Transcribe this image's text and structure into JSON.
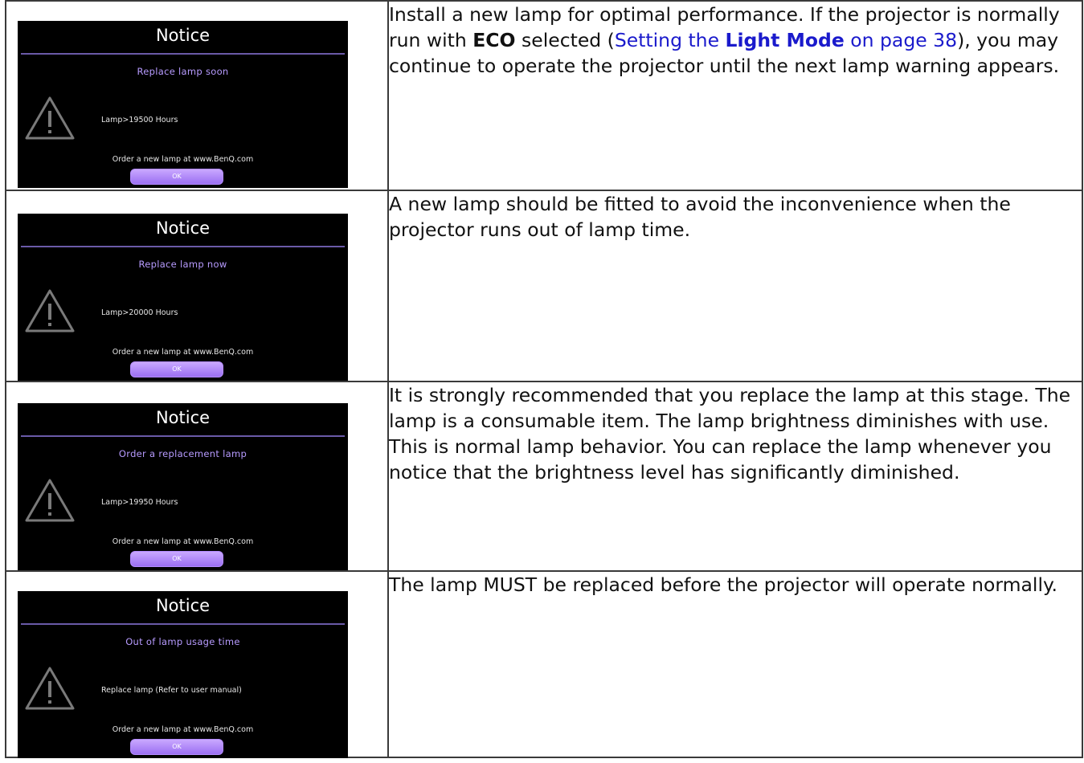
{
  "rows": [
    {
      "dialog": {
        "title": "Notice",
        "message": "Replace lamp soon",
        "detail": "Lamp>19500 Hours",
        "order": "Order a new lamp at www.BenQ.com",
        "button": "OK"
      },
      "text": {
        "p1": "Install a new lamp for optimal performance. If the projector is normally run with ",
        "kw1": "ECO",
        "p2": " selected (",
        "link_pre": "Setting the ",
        "link_kw": "Light Mode",
        "link_post": " on page 38",
        "p3": "), you may continue to operate the projector until the next lamp warning appears."
      }
    },
    {
      "dialog": {
        "title": "Notice",
        "message": "Replace lamp now",
        "detail": "Lamp>20000 Hours",
        "order": "Order a new lamp at www.BenQ.com",
        "button": "OK"
      },
      "text": "A new lamp should be fitted to avoid the inconvenience when the projector runs out of lamp time."
    },
    {
      "dialog": {
        "title": "Notice",
        "message": "Order a replacement lamp",
        "detail": "Lamp>19950 Hours",
        "order": "Order a new lamp at www.BenQ.com",
        "button": "OK"
      },
      "text": "It is strongly recommended that you replace the lamp at this stage. The lamp is a consumable item. The lamp brightness diminishes with use. This is normal lamp behavior. You can replace the lamp whenever you notice that the brightness level has significantly diminished."
    },
    {
      "dialog": {
        "title": "Notice",
        "message": "Out of lamp usage time",
        "detail": "Replace lamp (Refer to user manual)",
        "order": "Order a new lamp at www.BenQ.com",
        "button": "OK"
      },
      "text": "The lamp MUST be replaced before the projector will operate normally."
    }
  ],
  "colors": {
    "dialog_bg": "#000000",
    "accent_purple": "#b79bff",
    "link_blue": "#1a1acc"
  },
  "icons": {
    "warning": "warning-triangle-icon"
  }
}
